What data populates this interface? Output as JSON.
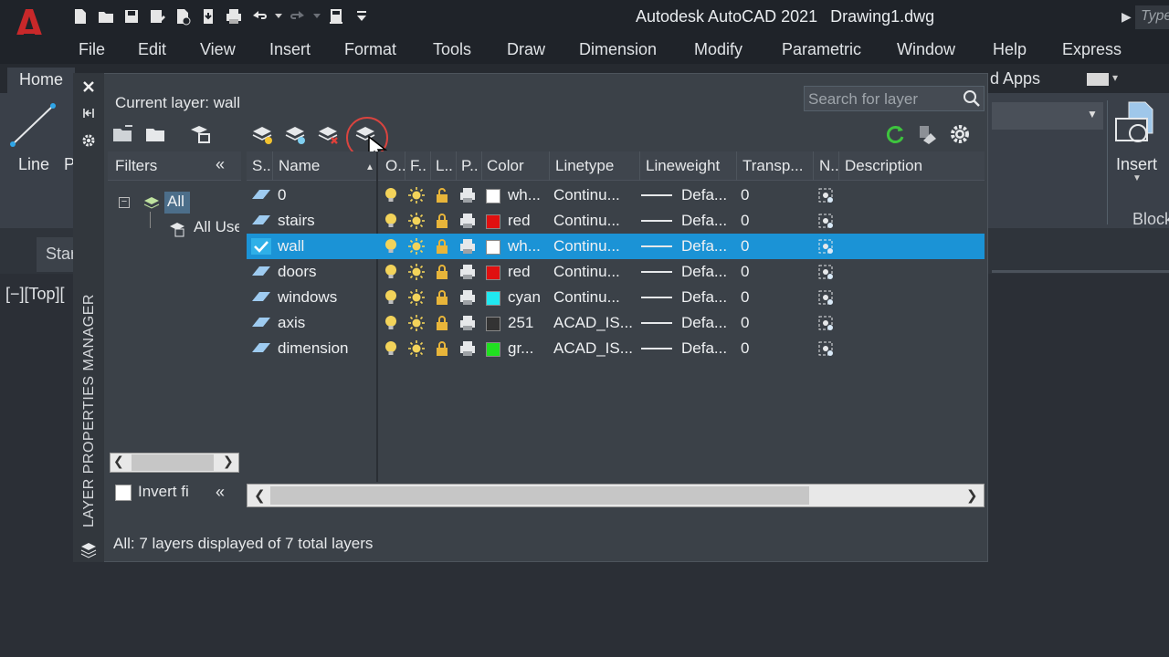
{
  "app": {
    "name": "Autodesk AutoCAD 2021",
    "document": "Drawing1.dwg",
    "type_search_placeholder": "Type"
  },
  "menu": [
    "File",
    "Edit",
    "View",
    "Insert",
    "Format",
    "Tools",
    "Draw",
    "Dimension",
    "Modify",
    "Parametric",
    "Window",
    "Help",
    "Express"
  ],
  "ribbon": {
    "active_tab": "Home",
    "partial_tab": "d Apps",
    "line_label": "Line",
    "partial_label": "P",
    "insert_label": "Insert",
    "block_label": "Block"
  },
  "drawing": {
    "file_tab": "Star",
    "view_label": "[−][Top]["
  },
  "palette": {
    "vertical_title": "LAYER PROPERTIES MANAGER",
    "current_layer": "Current layer: wall",
    "search_placeholder": "Search for layer",
    "filters_title": "Filters",
    "tree_all": "All",
    "tree_used": "All Used Layers",
    "invert_label": "Invert fi",
    "status_line": "All: 7 layers displayed of 7 total layers"
  },
  "columns": [
    "S..",
    "Name",
    "O..",
    "F..",
    "L..",
    "P..",
    "Color",
    "Linetype",
    "Lineweight",
    "Transp...",
    "N..",
    "Description"
  ],
  "layers": [
    {
      "name": "0",
      "current": false,
      "locked": false,
      "color_hex": "#ffffff",
      "color_name": "wh...",
      "linetype": "Continu...",
      "lineweight": "Defa...",
      "transparency": "0"
    },
    {
      "name": "stairs",
      "current": false,
      "locked": true,
      "color_hex": "#e01010",
      "color_name": "red",
      "linetype": "Continu...",
      "lineweight": "Defa...",
      "transparency": "0"
    },
    {
      "name": "wall",
      "current": true,
      "locked": true,
      "color_hex": "#ffffff",
      "color_name": "wh...",
      "linetype": "Continu...",
      "lineweight": "Defa...",
      "transparency": "0"
    },
    {
      "name": "doors",
      "current": false,
      "locked": true,
      "color_hex": "#e01010",
      "color_name": "red",
      "linetype": "Continu...",
      "lineweight": "Defa...",
      "transparency": "0"
    },
    {
      "name": "windows",
      "current": false,
      "locked": true,
      "color_hex": "#20e8f0",
      "color_name": "cyan",
      "linetype": "Continu...",
      "lineweight": "Defa...",
      "transparency": "0"
    },
    {
      "name": "axis",
      "current": false,
      "locked": true,
      "color_hex": "#333333",
      "color_name": "251",
      "linetype": "ACAD_IS...",
      "lineweight": "Defa...",
      "transparency": "0"
    },
    {
      "name": "dimension",
      "current": false,
      "locked": true,
      "color_hex": "#20e020",
      "color_name": "gr...",
      "linetype": "ACAD_IS...",
      "lineweight": "Defa...",
      "transparency": "0"
    }
  ],
  "colors": {
    "selection": "#1b93d6",
    "accent_green": "#3ec43e",
    "logo_red": "#c8282a"
  }
}
